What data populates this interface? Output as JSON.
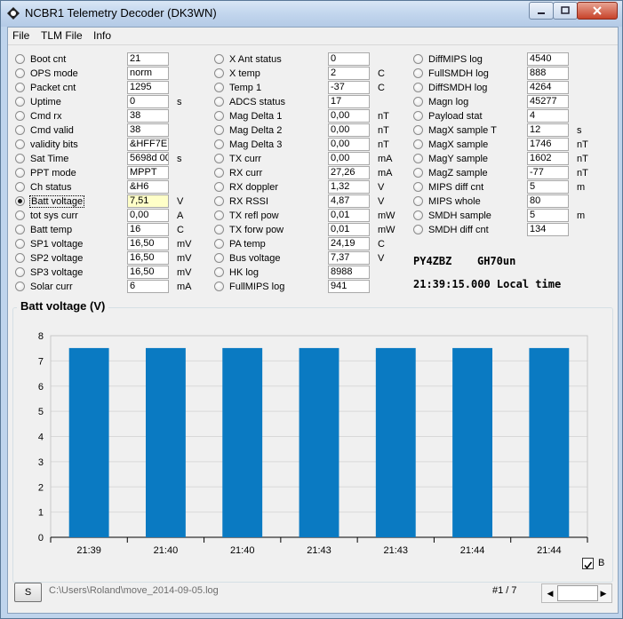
{
  "window": {
    "title": "NCBR1 Telemetry Decoder (DK3WN)"
  },
  "menu": [
    "File",
    "TLM File",
    "Info"
  ],
  "columns": [
    [
      {
        "label": "Boot cnt",
        "value": "21",
        "unit": ""
      },
      {
        "label": "OPS mode",
        "value": "norm",
        "unit": ""
      },
      {
        "label": "Packet cnt",
        "value": "1295",
        "unit": ""
      },
      {
        "label": "Uptime",
        "value": "0",
        "unit": "s"
      },
      {
        "label": "Cmd rx",
        "value": "38",
        "unit": ""
      },
      {
        "label": "Cmd valid",
        "value": "38",
        "unit": ""
      },
      {
        "label": "validity bits",
        "value": "&HFF7E",
        "unit": ""
      },
      {
        "label": "Sat Time",
        "value": "5698d 00",
        "unit": "s"
      },
      {
        "label": "PPT mode",
        "value": "MPPT",
        "unit": ""
      },
      {
        "label": "Ch status",
        "value": "&H6",
        "unit": ""
      },
      {
        "label": "Batt voltage",
        "value": "7,51",
        "unit": "V",
        "selected": true
      },
      {
        "label": "tot sys curr",
        "value": "0,00",
        "unit": "A"
      },
      {
        "label": "Batt temp",
        "value": "16",
        "unit": "C"
      },
      {
        "label": "SP1 voltage",
        "value": "16,50",
        "unit": "mV"
      },
      {
        "label": "SP2 voltage",
        "value": "16,50",
        "unit": "mV"
      },
      {
        "label": "SP3 voltage",
        "value": "16,50",
        "unit": "mV"
      },
      {
        "label": "Solar curr",
        "value": "6",
        "unit": "mA"
      }
    ],
    [
      {
        "label": "X Ant status",
        "value": "0",
        "unit": ""
      },
      {
        "label": "X temp",
        "value": "2",
        "unit": "C"
      },
      {
        "label": "Temp 1",
        "value": "-37",
        "unit": "C"
      },
      {
        "label": "ADCS status",
        "value": "17",
        "unit": ""
      },
      {
        "label": "Mag Delta 1",
        "value": "0,00",
        "unit": "nT"
      },
      {
        "label": "Mag Delta 2",
        "value": "0,00",
        "unit": "nT"
      },
      {
        "label": "Mag Delta 3",
        "value": "0,00",
        "unit": "nT"
      },
      {
        "label": "TX curr",
        "value": "0,00",
        "unit": "mA"
      },
      {
        "label": "RX curr",
        "value": "27,26",
        "unit": "mA"
      },
      {
        "label": "RX doppler",
        "value": "1,32",
        "unit": "V"
      },
      {
        "label": "RX RSSI",
        "value": "4,87",
        "unit": "V"
      },
      {
        "label": "TX refl pow",
        "value": "0,01",
        "unit": "mW"
      },
      {
        "label": "TX forw pow",
        "value": "0,01",
        "unit": "mW"
      },
      {
        "label": "PA temp",
        "value": "24,19",
        "unit": "C"
      },
      {
        "label": "Bus voltage",
        "value": "7,37",
        "unit": "V"
      },
      {
        "label": "HK log",
        "value": "8988",
        "unit": ""
      },
      {
        "label": "FullMIPS log",
        "value": "941",
        "unit": ""
      }
    ],
    [
      {
        "label": "DiffMIPS log",
        "value": "4540",
        "unit": ""
      },
      {
        "label": "FullSMDH log",
        "value": "888",
        "unit": ""
      },
      {
        "label": "DiffSMDH log",
        "value": "4264",
        "unit": ""
      },
      {
        "label": "Magn log",
        "value": "45277",
        "unit": ""
      },
      {
        "label": "Payload stat",
        "value": "4",
        "unit": ""
      },
      {
        "label": "MagX sample T",
        "value": "12",
        "unit": "s"
      },
      {
        "label": "MagX sample",
        "value": "1746",
        "unit": "nT"
      },
      {
        "label": "MagY sample",
        "value": "1602",
        "unit": "nT"
      },
      {
        "label": "MagZ sample",
        "value": "-77",
        "unit": "nT"
      },
      {
        "label": "MIPS diff cnt",
        "value": "5",
        "unit": "m"
      },
      {
        "label": "MIPS whole",
        "value": "80",
        "unit": ""
      },
      {
        "label": "SMDH sample",
        "value": "5",
        "unit": "m"
      },
      {
        "label": "SMDH diff cnt",
        "value": "134",
        "unit": ""
      }
    ]
  ],
  "info": {
    "station": "PY4ZBZ",
    "locator": "GH70un",
    "time": "21:39:15.000 Local time"
  },
  "chart_data": {
    "type": "bar",
    "title": "Batt voltage (V)",
    "categories": [
      "21:39",
      "21:40",
      "21:40",
      "21:43",
      "21:43",
      "21:44",
      "21:44"
    ],
    "values": [
      7.51,
      7.51,
      7.51,
      7.51,
      7.51,
      7.51,
      7.51
    ],
    "ylim": [
      0,
      8
    ],
    "yticks": [
      0,
      1,
      2,
      3,
      4,
      5,
      6,
      7,
      8
    ],
    "grid": true,
    "color": "#0a7ac2"
  },
  "checkbox": {
    "label": "B",
    "checked": true
  },
  "footer": {
    "button_label": "S",
    "path": "C:\\Users\\Roland\\move_2014-09-05.log",
    "page": "#1 / 7"
  }
}
